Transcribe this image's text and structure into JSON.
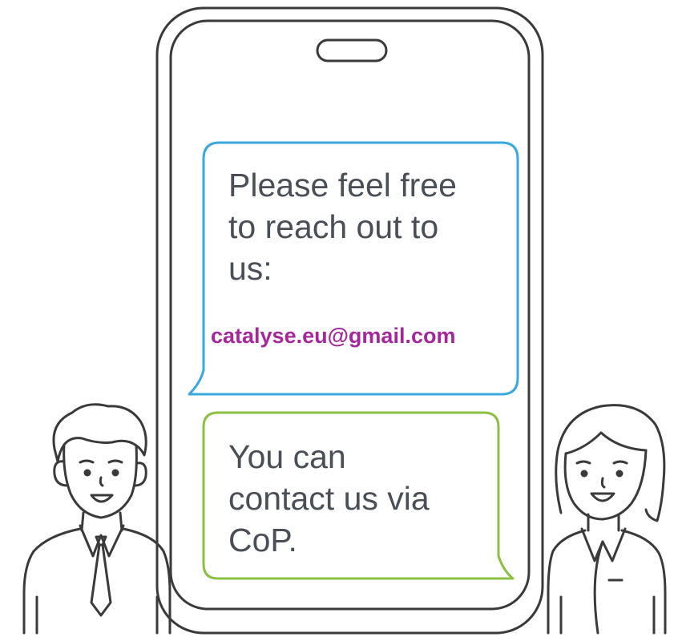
{
  "colors": {
    "outline": "#3a3a3a",
    "bubble_blue": "#3aa8dc",
    "bubble_green": "#8cc043",
    "email": "#a5289b",
    "text": "#4a4f57",
    "background": "#ffffff"
  },
  "bubble_top": {
    "lines": [
      "Please feel free",
      "to reach out to",
      "us:"
    ],
    "email": "catalyse.eu@gmail.com"
  },
  "bubble_bottom": {
    "lines": [
      "You can",
      "contact us via",
      "CoP."
    ]
  },
  "icons": {
    "phone": "smartphone-icon",
    "man": "man-avatar-icon",
    "woman": "woman-avatar-icon"
  }
}
